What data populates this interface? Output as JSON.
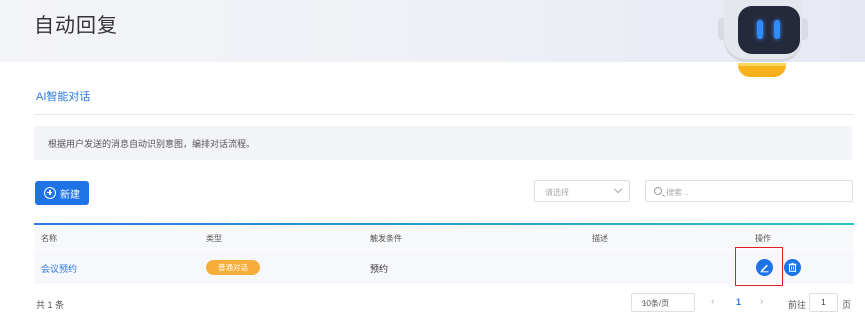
{
  "page": {
    "title": "自动回复"
  },
  "tabs": [
    {
      "label": "AI智能对话",
      "active": true
    }
  ],
  "info": {
    "text": "根据用户发送的消息自动识别意图，编排对话流程。"
  },
  "toolbar": {
    "new_label": "新建",
    "select_placeholder": "请选择",
    "search_placeholder": "搜索..."
  },
  "table": {
    "columns": [
      "名称",
      "类型",
      "触发条件",
      "描述",
      "操作"
    ],
    "rows": [
      {
        "name": "会议预约",
        "type": "普通对话",
        "condition": "预约",
        "description": ""
      }
    ]
  },
  "pagination": {
    "total": "共 1 条",
    "page_size": "10条/页",
    "prev": "‹",
    "current": "1",
    "next": "›",
    "goto_label": "前往",
    "goto_value": "1",
    "goto_unit": "页"
  },
  "icons": [
    "robot-icon",
    "plus-circle-icon",
    "chevron-down-icon",
    "search-icon",
    "edit-icon",
    "trash-icon"
  ],
  "colors": {
    "primary": "#1e73e6",
    "tag": "#f7ad3a",
    "highlight": "#e02020"
  }
}
